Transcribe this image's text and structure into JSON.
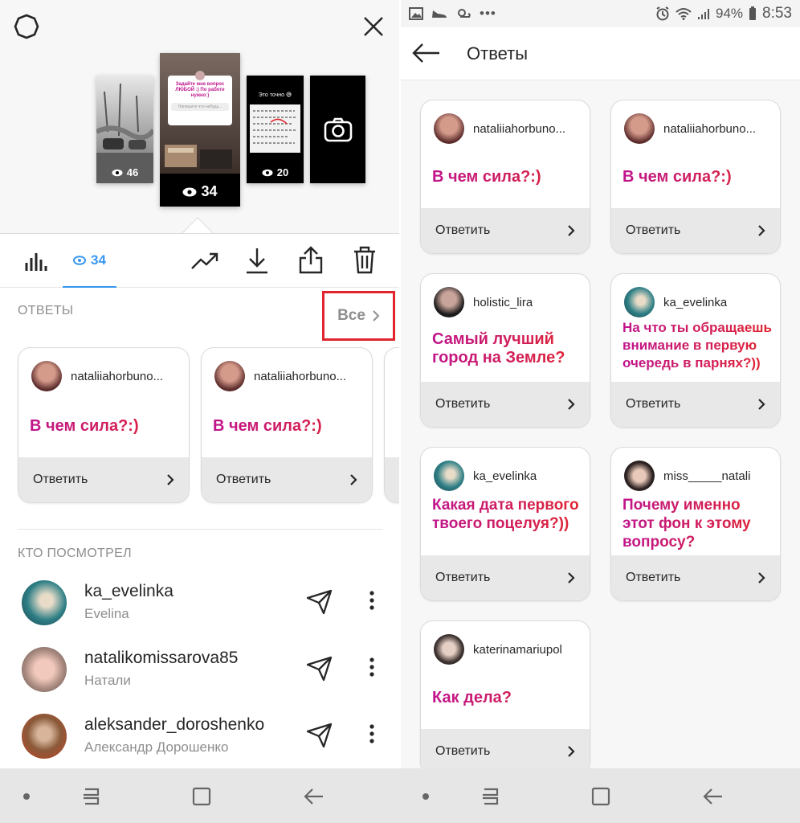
{
  "left": {
    "stories": [
      {
        "count": "46"
      },
      {
        "count": "34",
        "text": "Задайте мне вопрос ЛЮБОЙ :) По работе нужно:)",
        "input": "Напишите что-нибудь..."
      },
      {
        "count": "20",
        "text": "Это точно 😅"
      }
    ],
    "views_tab": {
      "count": "34"
    },
    "answers_section": {
      "title": "ОТВЕТЫ",
      "all_label": "Все"
    },
    "answer_cards": [
      {
        "username": "nataliiahorbuno...",
        "question": "В чем сила?:)",
        "reply": "Ответить"
      },
      {
        "username": "nataliiahorbuno...",
        "question": "В чем сила?:)",
        "reply": "Ответить"
      }
    ],
    "viewers_section": {
      "title": "КТО ПОСМОТРЕЛ"
    },
    "viewers": [
      {
        "username": "ka_evelinka",
        "name": "Evelina"
      },
      {
        "username": "natalikomissarova85",
        "name": "Натали"
      },
      {
        "username": "aleksander_doroshenko",
        "name": "Александр Дорошенко"
      }
    ]
  },
  "right": {
    "status": {
      "battery": "94%",
      "time": "8:53"
    },
    "title": "Ответы",
    "cards": [
      {
        "username": "nataliiahorbuno...",
        "question": "В чем сила?:)",
        "reply": "Ответить"
      },
      {
        "username": "nataliiahorbuno...",
        "question": "В чем сила?:)",
        "reply": "Ответить"
      },
      {
        "username": "holistic_lira",
        "question": "Самый лучший город на Земле?",
        "reply": "Ответить"
      },
      {
        "username": "ka_evelinka",
        "question": "На что ты обращаешь внимание в первую очередь в парнях?))",
        "reply": "Ответить"
      },
      {
        "username": "ka_evelinka",
        "question": "Какая дата первого твоего поцелуя?))",
        "reply": "Ответить"
      },
      {
        "username": "miss_____natali",
        "question": "Почему именно этот фон к этому вопросу?",
        "reply": "Ответить"
      },
      {
        "username": "katerinamariupol",
        "question": "Как дела?",
        "reply": "Ответить"
      }
    ]
  },
  "colors": {
    "accent": "#3897f0",
    "question_gradient_start": "#c0158c",
    "question_gradient_end": "#e0252f",
    "highlight_box": "#e0252f",
    "footer_bg": "#e8e8e8"
  }
}
